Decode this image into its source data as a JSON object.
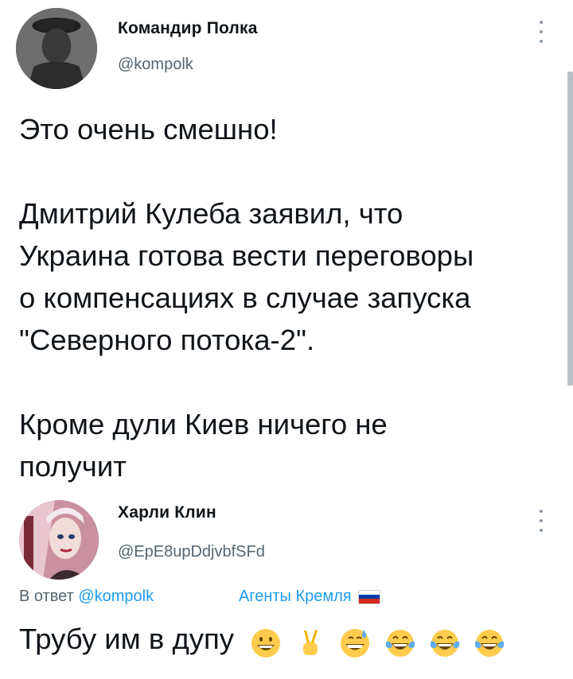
{
  "tweet1": {
    "author_name": "Командир Полка",
    "author_handle": "@kompolk",
    "text_lines": [
      "Это очень смешно!",
      "",
      "Дмитрий Кулеба заявил, что",
      "Украина готова вести переговоры",
      "о компенсациях в случае запуска",
      "\"Северного потока-2\".",
      "",
      "Кроме дули Киев ничего не",
      "получит"
    ]
  },
  "tweet2": {
    "author_name": "Харли Клин",
    "author_handle": "@EpE8upDdjvbfSFd",
    "reply_prefix": "В ответ ",
    "reply_mention": "@kompolk",
    "label": "Агенты Кремля",
    "text": "Трубу им в дупу",
    "emojis": [
      "grinning-face",
      "victory-hand",
      "grinning-sweat-face",
      "tears-of-joy-face",
      "tears-of-joy-face",
      "tears-of-joy-face"
    ]
  },
  "colors": {
    "text_primary": "#0f1419",
    "text_secondary": "#536471",
    "link": "#1d9bf0",
    "emoji_yellow": "#ffcc4d",
    "emoji_tear": "#5dadec",
    "flag_white": "#ffffff",
    "flag_blue": "#0039a6",
    "flag_red": "#d52b1e"
  },
  "icons": {
    "more": "more-vertical-icon",
    "flag": "russia-flag-icon"
  }
}
